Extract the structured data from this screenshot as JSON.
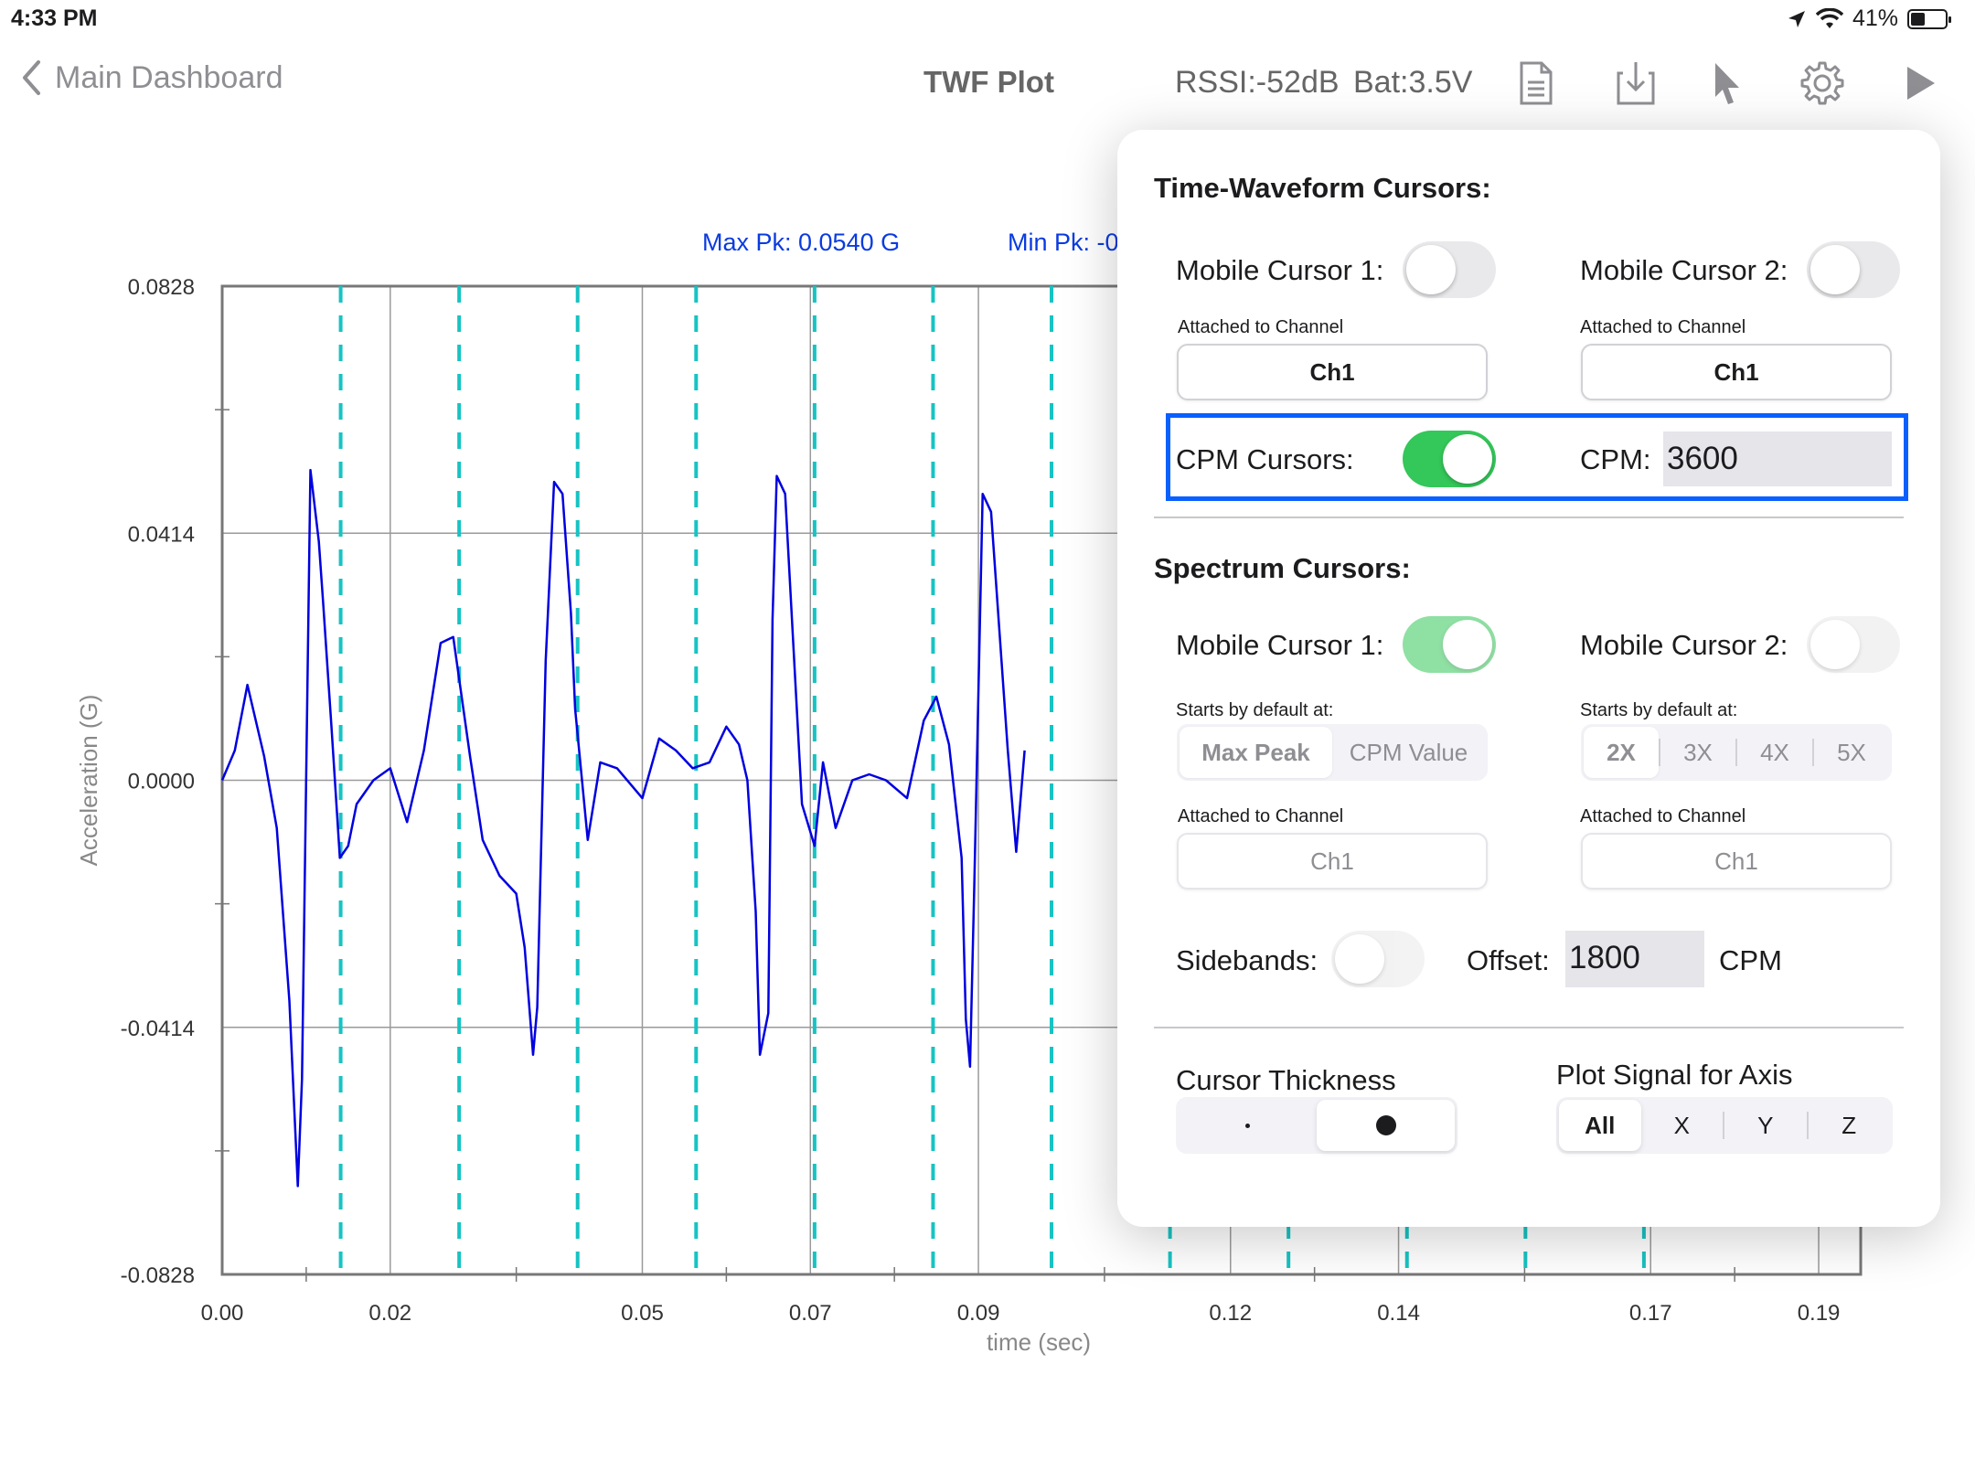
{
  "status_bar": {
    "time": "4:33 PM",
    "battery": "41%",
    "battery_level": 0.41
  },
  "nav": {
    "back_label": "Main Dashboard",
    "title": "TWF Plot",
    "rssi": "RSSI:-52dB",
    "battery": "Bat:3.5V",
    "icons": [
      "document-icon",
      "download-icon",
      "cursor-icon",
      "gear-icon",
      "play-icon"
    ]
  },
  "chart_meta": {
    "max_pk": "Max Pk: 0.0540 G",
    "min_pk": "Min Pk: -0",
    "ylabel": "Acceleration (G)",
    "xlabel": "time (sec)",
    "series_color": "#0000e0",
    "cursor_color": "#17c3c3"
  },
  "chart_data": {
    "type": "line",
    "title": "",
    "xlabel": "time (sec)",
    "ylabel": "Acceleration (G)",
    "xlim": [
      0.0,
      0.195
    ],
    "ylim": [
      -0.0828,
      0.0828
    ],
    "x_ticks": [
      "0.00",
      "0.02",
      "0.05",
      "0.07",
      "0.09",
      "0.12",
      "0.14",
      "0.17",
      "0.19"
    ],
    "x_tick_values": [
      0.0,
      0.02,
      0.05,
      0.07,
      0.09,
      0.12,
      0.14,
      0.17,
      0.19
    ],
    "y_ticks": [
      "0.0828",
      "0.0414",
      "0.0000",
      "-0.0414",
      "-0.0828"
    ],
    "y_tick_values": [
      0.0828,
      0.0414,
      0.0,
      -0.0414,
      -0.0828
    ],
    "grid": true,
    "series": [
      {
        "x": [
          0.0,
          0.0015,
          0.003,
          0.005,
          0.0065,
          0.008,
          0.009,
          0.0095,
          0.0105,
          0.0115,
          0.012,
          0.013,
          0.0135,
          0.014,
          0.015,
          0.016,
          0.018,
          0.02,
          0.022,
          0.024,
          0.026,
          0.0275,
          0.0285,
          0.0295,
          0.031,
          0.033,
          0.035,
          0.036,
          0.037,
          0.0375,
          0.0385,
          0.0395,
          0.0405,
          0.0415,
          0.042,
          0.0435,
          0.045,
          0.047,
          0.05,
          0.052,
          0.054,
          0.056,
          0.058,
          0.06,
          0.0615,
          0.0625,
          0.0635,
          0.064,
          0.065,
          0.0655,
          0.066,
          0.067,
          0.068,
          0.0685,
          0.069,
          0.0705,
          0.0715,
          0.073,
          0.075,
          0.077,
          0.079,
          0.0815,
          0.0835,
          0.085,
          0.0865,
          0.088,
          0.0885,
          0.089,
          0.0895,
          0.0905,
          0.0915,
          0.0935,
          0.0945,
          0.0955
        ],
        "y": [
          0.0,
          0.005,
          0.016,
          0.004,
          -0.008,
          -0.037,
          -0.068,
          -0.05,
          0.052,
          0.04,
          0.03,
          0.009,
          -0.002,
          -0.013,
          -0.011,
          -0.004,
          0.0,
          0.002,
          -0.007,
          0.005,
          0.023,
          0.024,
          0.014,
          0.004,
          -0.01,
          -0.016,
          -0.019,
          -0.028,
          -0.046,
          -0.038,
          0.02,
          0.05,
          0.048,
          0.028,
          0.012,
          -0.01,
          0.003,
          0.002,
          -0.003,
          0.007,
          0.005,
          0.002,
          0.003,
          0.009,
          0.006,
          0.0,
          -0.022,
          -0.046,
          -0.039,
          0.027,
          0.051,
          0.048,
          0.022,
          0.009,
          -0.004,
          -0.011,
          0.003,
          -0.008,
          0.0,
          0.001,
          0.0,
          -0.003,
          0.01,
          0.014,
          0.006,
          -0.013,
          -0.04,
          -0.048,
          -0.018,
          0.048,
          0.045,
          0.005,
          -0.012,
          0.005
        ]
      }
    ],
    "cursor_lines_x": [
      0.0141,
      0.0282,
      0.0423,
      0.0564,
      0.0705,
      0.0846,
      0.0987,
      0.1128,
      0.1269,
      0.141,
      0.1551,
      0.1692
    ]
  },
  "popover": {
    "twf_title": "Time-Waveform Cursors:",
    "mobile1_label": "Mobile Cursor 1:",
    "mobile2_label": "Mobile Cursor 2:",
    "attached_label": "Attached to Channel",
    "channel": "Ch1",
    "cpm_cursors_label": "CPM Cursors:",
    "cpm_label": "CPM:",
    "cpm_value": "3600",
    "spectrum_title": "Spectrum Cursors:",
    "starts_label": "Starts by default at:",
    "start_options": [
      "Max Peak",
      "CPM Value"
    ],
    "harmonic_options": [
      "2X",
      "3X",
      "4X",
      "5X"
    ],
    "sidebands_label": "Sidebands:",
    "offset_label": "Offset:",
    "offset_value": "1800",
    "offset_unit": "CPM",
    "thickness_label": "Cursor Thickness",
    "thickness_options": [
      "thin-dot",
      "thick-dot"
    ],
    "axis_label": "Plot Signal for Axis",
    "axis_options": [
      "All",
      "X",
      "Y",
      "Z"
    ]
  }
}
